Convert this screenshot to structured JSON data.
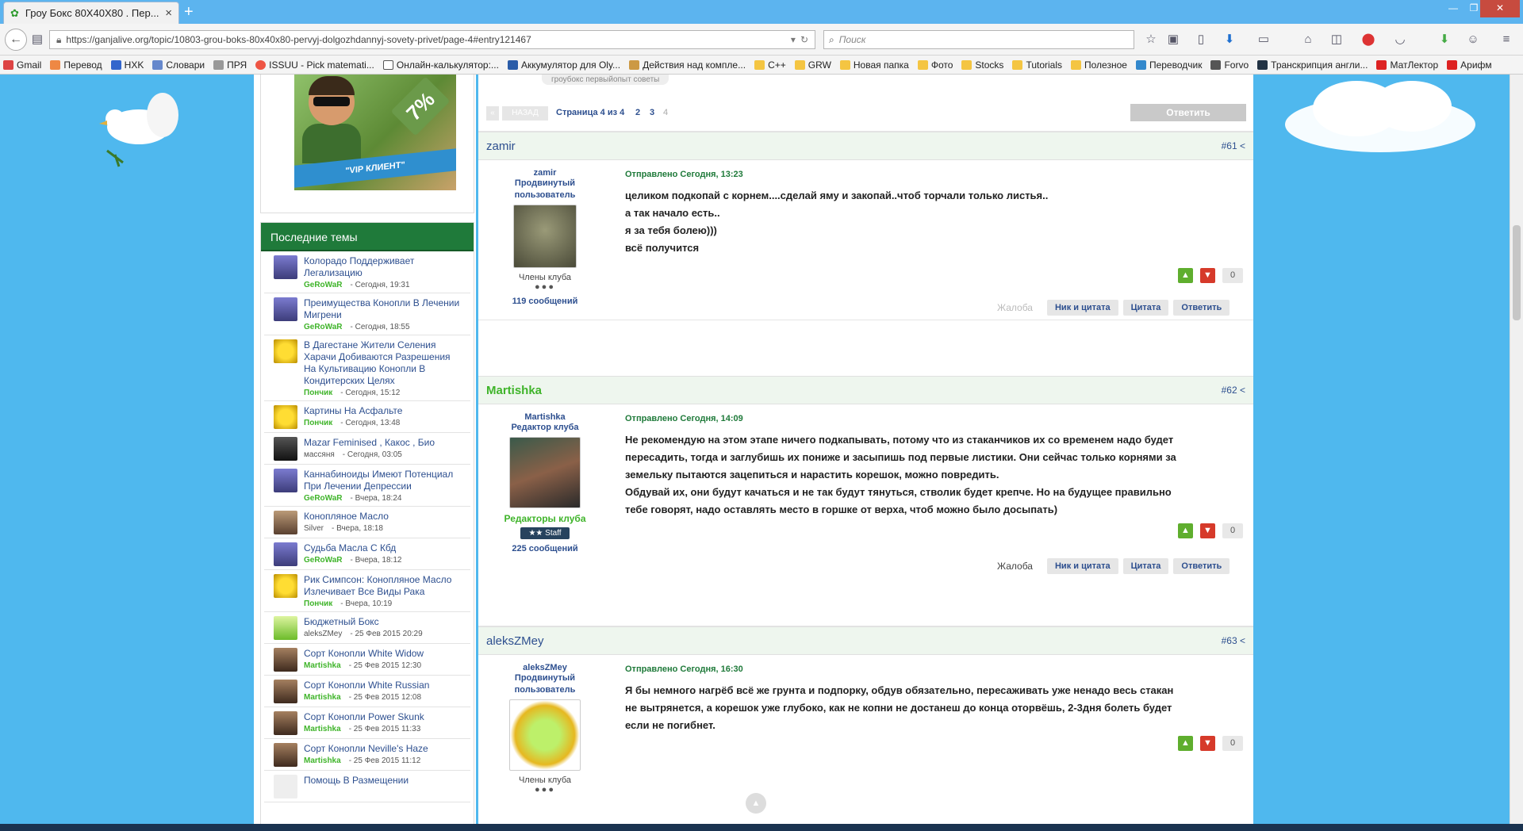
{
  "browser": {
    "tab_title": "Гроу Бокс 80X40X80 . Пер...",
    "url": "https://ganjalive.org/topic/10803-grou-boks-80x40x80-pervyj-dolgozhdannyj-sovety-privet/page-4#entry121467",
    "search_placeholder": "Поиск",
    "bookmarks": [
      "Gmail",
      "Перевод",
      "HXK",
      "Словари",
      "ПРЯ",
      "ISSUU - Pick matemati...",
      "Онлайн-калькулятор:...",
      "Аккумулятор для Oly...",
      "Действия над компле...",
      "C++",
      "GRW",
      "Новая папка",
      "Фото",
      "Stocks",
      "Tutorials",
      "Полезное",
      "Переводчик",
      "Forvo",
      "Транскрипция англи...",
      "МатЛектор",
      "Арифм"
    ]
  },
  "sidebar": {
    "vip_label": "\"VIP КЛИЕНТ\"",
    "vip_percent": "7%",
    "recent_title": "Последние темы",
    "topics": [
      {
        "title": "Колорадо Поддерживает Легализацию",
        "author": "GeRoWaR",
        "date": "- Сегодня, 19:31"
      },
      {
        "title": "Преимущества Конопли В Лечении Мигрени",
        "author": "GeRoWaR",
        "date": "- Сегодня, 18:55"
      },
      {
        "title": "В Дагестане Жители Селения Харачи Добиваются Разрешения На Культивацию Конопли В Кондитерских Целях",
        "author": "Пончик",
        "date": "- Сегодня, 15:12"
      },
      {
        "title": "Картины На Асфальте",
        "author": "Пончик",
        "date": "- Сегодня, 13:48"
      },
      {
        "title": "Mazar Feminised , Какос , Био",
        "author": "массяня",
        "date": "- Сегодня, 03:05"
      },
      {
        "title": "Каннабиноиды Имеют Потенциал При Лечении Депрессии",
        "author": "GeRoWaR",
        "date": "- Вчера, 18:24"
      },
      {
        "title": "Конопляное Масло",
        "author": "Silver",
        "date": "- Вчера, 18:18"
      },
      {
        "title": "Судьба Масла С Кбд",
        "author": "GeRoWaR",
        "date": "- Вчера, 18:12"
      },
      {
        "title": "Рик Симпсон: Конопляное Масло Излечивает Все Виды Рака",
        "author": "Пончик",
        "date": "- Вчера, 10:19"
      },
      {
        "title": "Бюджетный Бокс",
        "author": "aleksZMey",
        "date": "- 25 Фев 2015 20:29"
      },
      {
        "title": "Сорт Конопли White Widow",
        "author": "Martishka",
        "date": "- 25 Фев 2015 12:30"
      },
      {
        "title": "Сорт Конопли White Russian",
        "author": "Martishka",
        "date": "- 25 Фев 2015 12:08"
      },
      {
        "title": "Сорт Конопли Power Skunk",
        "author": "Martishka",
        "date": "- 25 Фев 2015 11:33"
      },
      {
        "title": "Сорт Конопли Neville's Haze",
        "author": "Martishka",
        "date": "- 25 Фев 2015 11:12"
      },
      {
        "title": "Помощь В Размещении",
        "author": "",
        "date": ""
      }
    ]
  },
  "pagination": {
    "prev_label": "НАЗАД",
    "label": "Страница 4 из 4",
    "pages": [
      "2",
      "3"
    ],
    "current": "4",
    "reply": "Ответить",
    "tags": "гроубокс первыйопыт советы"
  },
  "posts": [
    {
      "author": "zamir",
      "num": "#61",
      "name": "zamir",
      "role": "Продвинутый пользователь",
      "group": "Члены клуба",
      "count": "119 сообщений",
      "date": "Отправлено Сегодня, 13:23",
      "lines": [
        "целиком подкопай с корнем....сделай яму и закопай..чтоб торчали только листья..",
        "а так начало есть..",
        "я за тебя болею)))",
        "всё получится"
      ],
      "votes": "0"
    },
    {
      "author": "Martishka",
      "num": "#62",
      "name": "Martishka",
      "role": "Редактор клуба",
      "group": "Редакторы клуба",
      "badge": "Staff",
      "count": "225 сообщений",
      "date": "Отправлено Сегодня, 14:09",
      "lines": [
        "Не рекомендую на этом этапе ничего подкапывать, потому что из стаканчиков их со временем надо будет",
        "пересадить, тогда и заглубишь их пониже и засыпишь под первые листики. Они сейчас только корнями за",
        "земельку пытаются зацепиться и нарастить корешок, можно повредить.",
        "Обдувай их, они будут качаться и не так будут тянуться, стволик будет крепче. Но на будущее правильно",
        "тебе говорят, надо оставлять место в горшке от верха, чтоб можно было досыпать)"
      ],
      "votes": "0"
    },
    {
      "author": "aleksZMey",
      "num": "#63",
      "name": "aleksZMey",
      "role": "Продвинутый пользователь",
      "group": "Члены клуба",
      "date": "Отправлено Сегодня, 16:30",
      "lines": [
        "Я бы немного нагрёб всё же грунта и подпорку, обдув обязательно, пересаживать уже ненадо весь стакан",
        "не вытрянется, а корешок уже глубоко, как не копни не достанеш до конца оторвёшь, 2-3дня болеть будет",
        "если не погибнет."
      ],
      "votes": "0"
    }
  ],
  "actions": {
    "report": "Жалоба",
    "nick_quote": "Ник и цитата",
    "quote": "Цитата",
    "reply": "Ответить"
  }
}
